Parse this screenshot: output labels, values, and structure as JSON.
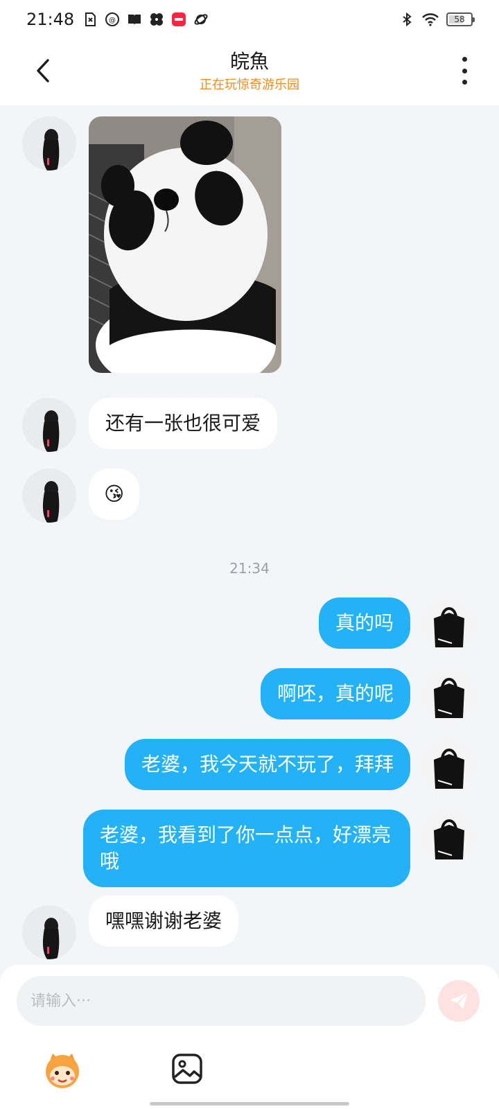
{
  "status_bar": {
    "time": "21:48",
    "battery": "58",
    "battery_percent": 58,
    "left_icons": [
      "sim-error-icon",
      "messenger-icon",
      "book-icon",
      "fan-icon",
      "redbook-app-icon",
      "planet-icon"
    ],
    "right_icons": [
      "bluetooth-icon",
      "wifi-icon",
      "battery-icon"
    ]
  },
  "header": {
    "title": "皖魚",
    "subtitle": "正在玩惊奇游乐园",
    "subtitle_color": "#f08c1f"
  },
  "chat": {
    "messages": [
      {
        "side": "left",
        "type": "image",
        "alt": "panda plush photo"
      },
      {
        "side": "left",
        "type": "text",
        "text": "还有一张也很可爱"
      },
      {
        "side": "left",
        "type": "emoji",
        "text": "😘"
      },
      {
        "type": "timestamp",
        "text": "21:34"
      },
      {
        "side": "right",
        "type": "text",
        "text": "真的吗"
      },
      {
        "side": "right",
        "type": "text",
        "text": "啊呸，真的呢"
      },
      {
        "side": "right",
        "type": "text",
        "text": "老婆，我今天就不玩了，拜拜"
      },
      {
        "side": "right",
        "type": "text",
        "text": "老婆，我看到了你一点点，好漂亮哦"
      },
      {
        "side": "left",
        "type": "text",
        "text": "嘿嘿谢谢老婆"
      }
    ],
    "outgoing_bubble_color": "#24b2f6"
  },
  "input": {
    "placeholder": "请输入···",
    "value": "",
    "send_icon": "send-plane-icon",
    "tools": [
      "emoji-mascot-icon",
      "image-icon"
    ]
  }
}
